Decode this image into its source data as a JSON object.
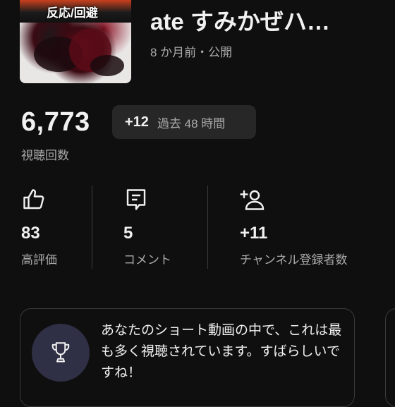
{
  "video": {
    "thumbnail_caption": "反応/回避",
    "title": "ate すみかぜハ…",
    "meta": "8 か月前・公開"
  },
  "views": {
    "count": "6,773",
    "label": "視聴回数",
    "delta": "+12",
    "period": "過去 48 時間"
  },
  "stats": [
    {
      "icon": "thumbs-up-icon",
      "value": "83",
      "label": "高評価"
    },
    {
      "icon": "comment-icon",
      "value": "5",
      "label": "コメント"
    },
    {
      "icon": "add-subscriber-icon",
      "value": "+11",
      "label": "チャンネル登録者数"
    }
  ],
  "insight": {
    "icon": "trophy-icon",
    "text": "あなたのショート動画の中で、これは最も多く視聴されています。すばらしいですね！"
  },
  "colors": {
    "background": "#0f0f0f",
    "chip": "#272727",
    "secondary_text": "#aaaaaa",
    "trophy_circle": "#2f2f45"
  }
}
